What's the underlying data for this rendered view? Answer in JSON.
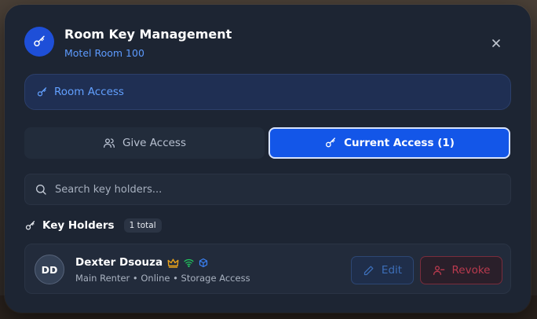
{
  "colors": {
    "modal_bg": "#1d2533",
    "accent_blue": "#1356e8",
    "link_blue": "#5d9bff",
    "revoke_red": "#b93a4e",
    "crown_gold": "#e9a21a",
    "signal_green": "#22c55e",
    "cube_blue": "#3b82f6"
  },
  "header": {
    "icon": "key-icon",
    "title": "Room Key Management",
    "subtitle": "Motel Room 100",
    "close_icon": "close-icon"
  },
  "banner": {
    "icon": "key-icon",
    "label": "Room Access"
  },
  "tabs": [
    {
      "icon": "users-icon",
      "label": "Give Access",
      "active": false
    },
    {
      "icon": "key-icon",
      "label": "Current Access (1)",
      "active": true
    }
  ],
  "search": {
    "icon": "search-icon",
    "value": "",
    "placeholder": "Search key holders..."
  },
  "key_holders": {
    "icon": "key-icon",
    "title": "Key Holders",
    "badge": "1 total",
    "items": [
      {
        "initials": "DD",
        "name": "Dexter Dsouza",
        "icons": [
          "crown-icon",
          "wifi-icon",
          "cube-icon"
        ],
        "meta": "Main Renter • Online • Storage Access",
        "edit_label": "Edit",
        "revoke_label": "Revoke"
      }
    ]
  }
}
